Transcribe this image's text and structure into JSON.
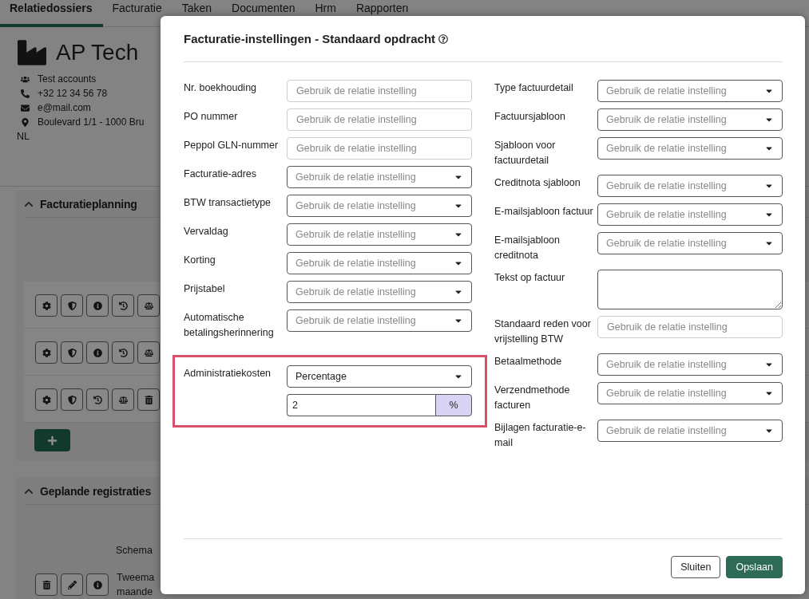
{
  "tabs": [
    {
      "label": "Relatiedossiers",
      "selected": true
    },
    {
      "label": "Facturatie",
      "selected": false
    },
    {
      "label": "Taken",
      "selected": false
    },
    {
      "label": "Documenten",
      "selected": false
    },
    {
      "label": "Hrm",
      "selected": false
    },
    {
      "label": "Rapporten",
      "selected": false
    }
  ],
  "company": {
    "name": "AP Tech",
    "details": [
      {
        "kind": "group",
        "text": "Test accounts"
      },
      {
        "kind": "phone",
        "text": "+32 12 34 56 78"
      },
      {
        "kind": "email",
        "text": "e@mail.com"
      },
      {
        "kind": "address",
        "text": "Boulevard 1/1 - 1000 Bru"
      }
    ],
    "country": "NL"
  },
  "planning": {
    "title": "Facturatieplanning",
    "expanded": true,
    "rows": [
      {
        "actions": [
          {
            "kind": "settings"
          },
          {
            "kind": "shield"
          },
          {
            "kind": "info"
          },
          {
            "kind": "history"
          },
          {
            "kind": "scale"
          }
        ]
      },
      {
        "actions": [
          {
            "kind": "settings"
          },
          {
            "kind": "shield"
          },
          {
            "kind": "info"
          },
          {
            "kind": "history"
          },
          {
            "kind": "scale"
          }
        ]
      },
      {
        "actions": [
          {
            "kind": "settings"
          },
          {
            "kind": "shield"
          },
          {
            "kind": "history"
          },
          {
            "kind": "scale"
          },
          {
            "kind": "trash"
          }
        ]
      }
    ]
  },
  "scheduled": {
    "title": "Geplande registraties",
    "expanded": true,
    "column_1": "Schema",
    "rows": [
      {
        "actions": [
          {
            "kind": "trash"
          },
          {
            "kind": "edit"
          },
          {
            "kind": "info"
          }
        ],
        "lines": [
          "Tweema",
          "maande"
        ]
      }
    ]
  },
  "dialog": {
    "title": "Facturatie-instellingen - Standaard opdracht",
    "left_fields": [
      {
        "label": "Nr. boekhouding",
        "kind": "input",
        "placeholder": "Gebruik de relatie instelling"
      },
      {
        "label": "PO nummer",
        "kind": "input",
        "placeholder": "Gebruik de relatie instelling"
      },
      {
        "label": "Peppol GLN-nummer",
        "kind": "input",
        "placeholder": "Gebruik de relatie instelling"
      },
      {
        "label": "Facturatie-adres",
        "kind": "select",
        "placeholder": "Gebruik de relatie instelling"
      },
      {
        "label": "BTW transactietype",
        "kind": "select",
        "placeholder": "Gebruik de relatie instelling"
      },
      {
        "label": "Vervaldag",
        "kind": "select",
        "placeholder": "Gebruik de relatie instelling"
      },
      {
        "label": "Korting",
        "kind": "select",
        "placeholder": "Gebruik de relatie instelling"
      },
      {
        "label": "Prijstabel",
        "kind": "select",
        "placeholder": "Gebruik de relatie instelling"
      },
      {
        "label": "Automatische betalingsherinnering",
        "kind": "select",
        "placeholder": "Gebruik de relatie instelling"
      }
    ],
    "highlighted_field": {
      "label": "Administratiekosten",
      "value": "Percentage",
      "amount": "2",
      "unit": "%"
    },
    "right_fields": [
      {
        "label": "Type factuurdetail",
        "kind": "select",
        "placeholder": "Gebruik de relatie instelling"
      },
      {
        "label": "Factuursjabloon",
        "kind": "select",
        "placeholder": "Gebruik de relatie instelling"
      },
      {
        "label": "Sjabloon voor factuurdetail",
        "kind": "select",
        "placeholder": "Gebruik de relatie instelling"
      },
      {
        "label": "Creditnota sjabloon",
        "kind": "select",
        "placeholder": "Gebruik de relatie instelling"
      },
      {
        "label": "E-mailsjabloon factuur",
        "kind": "select",
        "placeholder": "Gebruik de relatie instelling"
      },
      {
        "label": "E-mailsjabloon creditnota",
        "kind": "select",
        "placeholder": "Gebruik de relatie instelling"
      },
      {
        "label": "Tekst op factuur",
        "kind": "textarea"
      },
      {
        "label": "Standaard reden voor vrijstelling BTW",
        "kind": "input",
        "placeholder": "Gebruik de relatie instelling"
      },
      {
        "label": "Betaalmethode",
        "kind": "select",
        "placeholder": "Gebruik de relatie instelling"
      },
      {
        "label": "Verzendmethode facturen",
        "kind": "select",
        "placeholder": "Gebruik de relatie instelling"
      },
      {
        "label": "Bijlagen facturatie-e-mail",
        "kind": "select",
        "placeholder": "Gebruik de relatie instelling"
      }
    ],
    "buttons": [
      {
        "label": "Sluiten",
        "kind": "secondary"
      },
      {
        "label": "Opslaan",
        "kind": "primary"
      }
    ]
  }
}
